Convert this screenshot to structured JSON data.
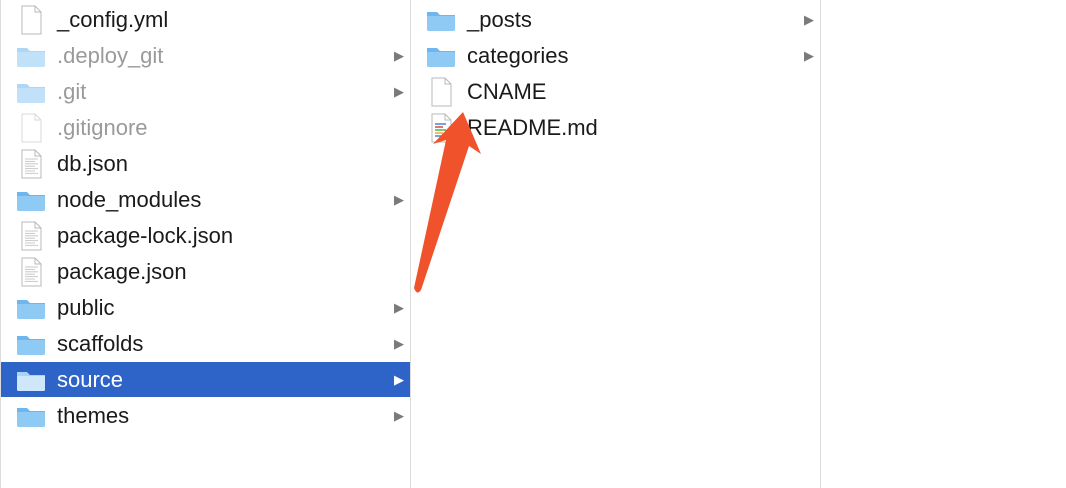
{
  "column1": {
    "items": [
      {
        "name": "_config.yml",
        "kind": "file",
        "dim": false,
        "selected": false
      },
      {
        "name": ".deploy_git",
        "kind": "folder",
        "dim": true,
        "selected": false
      },
      {
        "name": ".git",
        "kind": "folder",
        "dim": true,
        "selected": false
      },
      {
        "name": ".gitignore",
        "kind": "file",
        "dim": true,
        "selected": false
      },
      {
        "name": "db.json",
        "kind": "doc",
        "dim": false,
        "selected": false
      },
      {
        "name": "node_modules",
        "kind": "folder",
        "dim": false,
        "selected": false
      },
      {
        "name": "package-lock.json",
        "kind": "doc",
        "dim": false,
        "selected": false
      },
      {
        "name": "package.json",
        "kind": "doc",
        "dim": false,
        "selected": false
      },
      {
        "name": "public",
        "kind": "folder",
        "dim": false,
        "selected": false
      },
      {
        "name": "scaffolds",
        "kind": "folder",
        "dim": false,
        "selected": false
      },
      {
        "name": "source",
        "kind": "folder",
        "dim": false,
        "selected": true
      },
      {
        "name": "themes",
        "kind": "folder",
        "dim": false,
        "selected": false
      }
    ]
  },
  "column2": {
    "items": [
      {
        "name": "_posts",
        "kind": "folder",
        "dim": false,
        "selected": false
      },
      {
        "name": "categories",
        "kind": "folder",
        "dim": false,
        "selected": false
      },
      {
        "name": "CNAME",
        "kind": "file",
        "dim": false,
        "selected": false
      },
      {
        "name": "README.md",
        "kind": "markdown",
        "dim": false,
        "selected": false
      }
    ]
  },
  "chevron_glyph": "▶",
  "colors": {
    "selection": "#2e64c8",
    "folder": "#7cc0f2",
    "annotation_arrow": "#f0522b"
  },
  "annotation": {
    "type": "arrow",
    "points_to": "CNAME"
  }
}
